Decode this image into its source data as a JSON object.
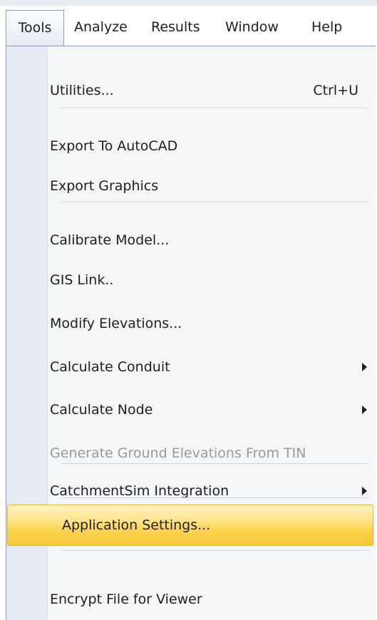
{
  "menubar": {
    "items": [
      {
        "label": "Tools"
      },
      {
        "label": "Analyze"
      },
      {
        "label": "Results"
      },
      {
        "label": "Window"
      },
      {
        "label": "Help"
      }
    ],
    "active_item": "Tools"
  },
  "tools_menu": {
    "items": [
      {
        "label": "Utilities...",
        "shortcut": "Ctrl+U",
        "enabled": true
      },
      {
        "label": "Export To AutoCAD",
        "enabled": true
      },
      {
        "label": "Export Graphics",
        "enabled": true
      },
      {
        "label": "Calibrate Model...",
        "enabled": true
      },
      {
        "label": "GIS Link..",
        "enabled": true
      },
      {
        "label": "Modify Elevations...",
        "enabled": true
      },
      {
        "label": "Calculate Conduit",
        "has_submenu": true,
        "enabled": true
      },
      {
        "label": "Calculate Node",
        "has_submenu": true,
        "enabled": true
      },
      {
        "label": "Generate Ground Elevations From TIN",
        "enabled": false
      },
      {
        "label": "CatchmentSim Integration",
        "has_submenu": true,
        "enabled": true
      },
      {
        "label": "Application Settings...",
        "enabled": true,
        "highlighted": true
      },
      {
        "label": "Encrypt File for Viewer",
        "enabled": true
      }
    ]
  },
  "colors": {
    "highlight_top": "#fff3c2",
    "highlight_bottom": "#f9c838",
    "highlight_border": "#e0b63a",
    "disabled_text": "#9a9a9a",
    "gutter": "#e6ecf4"
  }
}
